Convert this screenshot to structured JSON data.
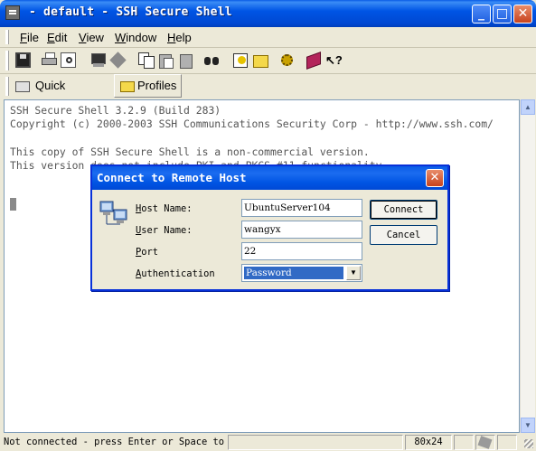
{
  "window": {
    "title": "- default - SSH Secure Shell",
    "controls": {
      "minimize": "_",
      "maximize": "□",
      "close": "✕"
    }
  },
  "menu": {
    "items": [
      {
        "label": "File",
        "key": "F",
        "rest": "ile"
      },
      {
        "label": "Edit",
        "key": "E",
        "rest": "dit"
      },
      {
        "label": "View",
        "key": "V",
        "rest": "iew"
      },
      {
        "label": "Window",
        "key": "W",
        "rest": "indow"
      },
      {
        "label": "Help",
        "key": "H",
        "rest": "elp"
      }
    ]
  },
  "toolbar": {
    "icons": [
      "save-icon",
      "print-icon",
      "print-preview-icon",
      "new-terminal-icon",
      "new-file-transfer-icon",
      "copy-icon",
      "paste-icon",
      "paste-special-icon",
      "find-icon",
      "settings-icon",
      "profiles-icon",
      "settings-gear-icon",
      "help-book-icon",
      "whats-this-icon"
    ]
  },
  "quickbar": {
    "quick_connect": "Quick Connect",
    "profiles": "Profiles"
  },
  "terminal": {
    "lines": [
      "SSH Secure Shell 3.2.9 (Build 283)",
      "Copyright (c) 2000-2003 SSH Communications Security Corp - http://www.ssh.com/",
      "",
      "This copy of SSH Secure Shell is a non-commercial version.",
      "This version does not include PKI and PKCS #11 functionality."
    ]
  },
  "status": {
    "message": "Not connected - press Enter or Space to connect",
    "size": "80x24"
  },
  "dialog": {
    "title": "Connect to Remote Host",
    "fields": {
      "host_name": {
        "label": "Host Name:",
        "key": "H",
        "rest": "ost Name:",
        "value": "UbuntuServer104"
      },
      "user_name": {
        "label": "User Name:",
        "key": "U",
        "rest": "ser Name:",
        "value": "wangyx"
      },
      "port": {
        "label": "Port",
        "key": "P",
        "rest": "ort",
        "value": "22"
      },
      "authentication": {
        "label": "Authentication",
        "key": "A",
        "rest": "uthentication",
        "value": "Password"
      }
    },
    "buttons": {
      "connect": "Connect",
      "cancel": "Cancel"
    }
  }
}
